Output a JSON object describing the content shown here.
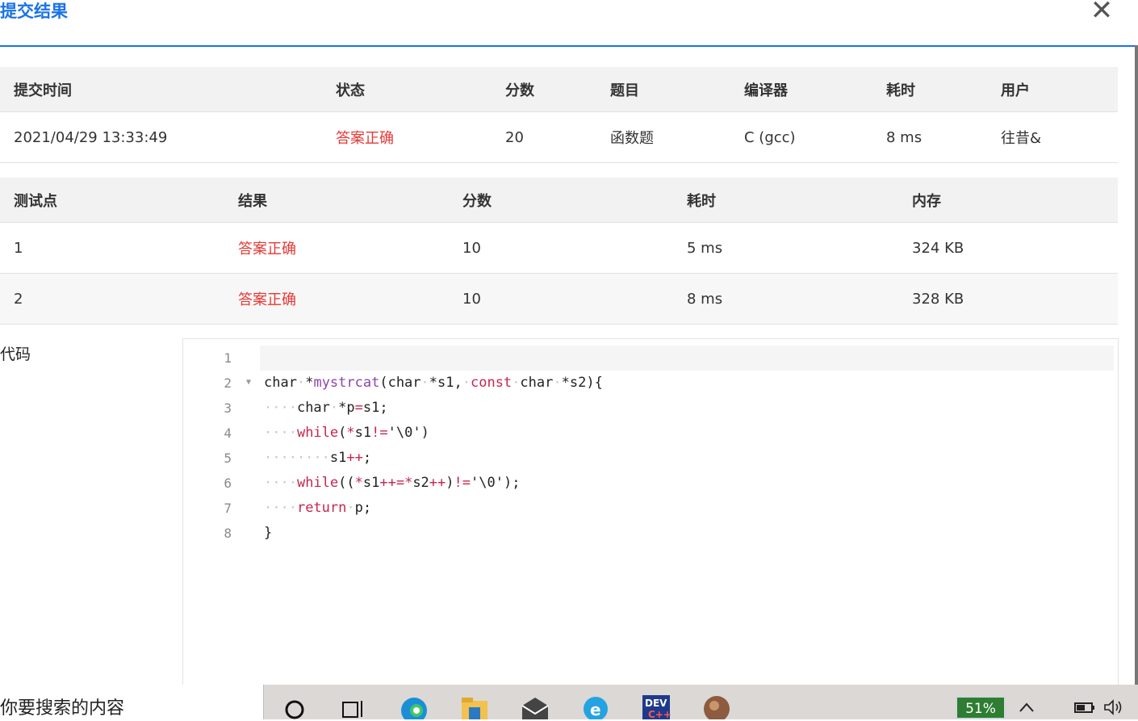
{
  "dialog": {
    "title": "提交结果",
    "close_symbol": "✕"
  },
  "summary": {
    "headers": [
      "提交时间",
      "状态",
      "分数",
      "题目",
      "编译器",
      "耗时",
      "用户"
    ],
    "row": [
      "2021/04/29 13:33:49",
      "答案正确",
      "20",
      "函数题",
      "C (gcc)",
      "8 ms",
      "往昔&"
    ]
  },
  "cases": {
    "headers": [
      "测试点",
      "结果",
      "分数",
      "耗时",
      "内存"
    ],
    "rows": [
      [
        "1",
        "答案正确",
        "10",
        "5 ms",
        "324 KB"
      ],
      [
        "2",
        "答案正确",
        "10",
        "8 ms",
        "328 KB"
      ]
    ]
  },
  "code": {
    "label": "代码",
    "line_numbers": [
      "1",
      "2",
      "3",
      "4",
      "5",
      "6",
      "7",
      "8"
    ]
  },
  "taskbar": {
    "search_placeholder": "你要搜索的内容",
    "battery_pill": "51%",
    "icons": [
      "cortana-icon",
      "task-view-icon",
      "edge-icon",
      "file-explorer-icon",
      "mail-icon",
      "ie-icon",
      "devcpp-icon",
      "avatar-icon"
    ],
    "tray_icons": [
      "chevron-up-icon",
      "battery-icon",
      "volume-icon"
    ]
  },
  "colors": {
    "accent": "#1a73e8",
    "status_ok": "#e53935"
  }
}
